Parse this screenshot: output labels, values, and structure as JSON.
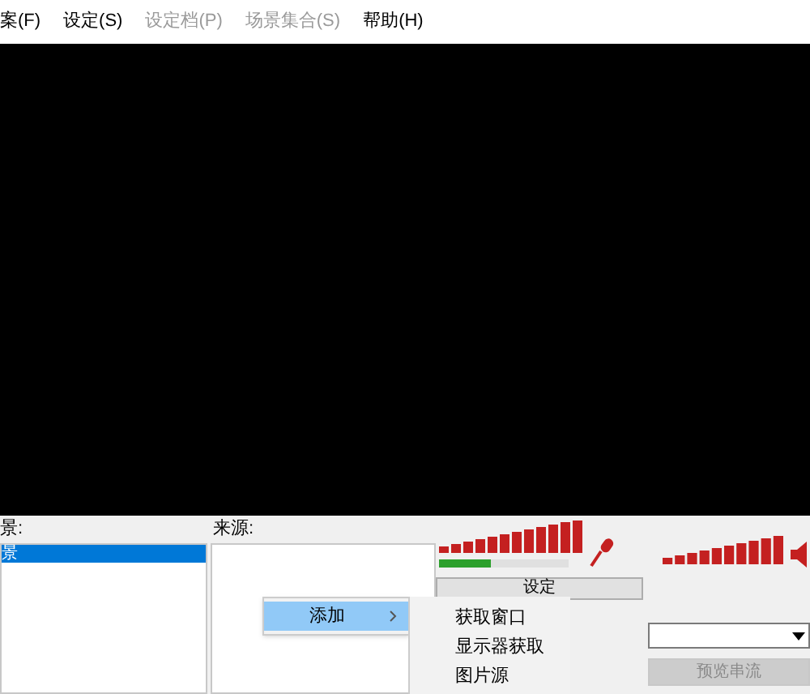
{
  "menu_bar": [
    {
      "label": "案(F)",
      "disabled": false
    },
    {
      "label": "设定(S)",
      "disabled": false
    },
    {
      "label": "设定档(P)",
      "disabled": true
    },
    {
      "label": "场景集合(S)",
      "disabled": true
    },
    {
      "label": "帮助(H)",
      "disabled": false
    }
  ],
  "scenes": {
    "label": "景:",
    "items": [
      {
        "label": "景",
        "selected": true
      }
    ]
  },
  "sources": {
    "label": "来源:"
  },
  "audio": {
    "mic_meter": {
      "level": 0.4
    }
  },
  "controls": {
    "settings_button": "设定",
    "preview_button": {
      "label": "预览串流",
      "disabled": true
    }
  },
  "context_menu": {
    "items": [
      {
        "label": "添加",
        "selected": true,
        "submenu": true
      }
    ],
    "submenu": [
      {
        "label": "获取窗口"
      },
      {
        "label": "显示器获取"
      },
      {
        "label": "图片源"
      }
    ]
  }
}
